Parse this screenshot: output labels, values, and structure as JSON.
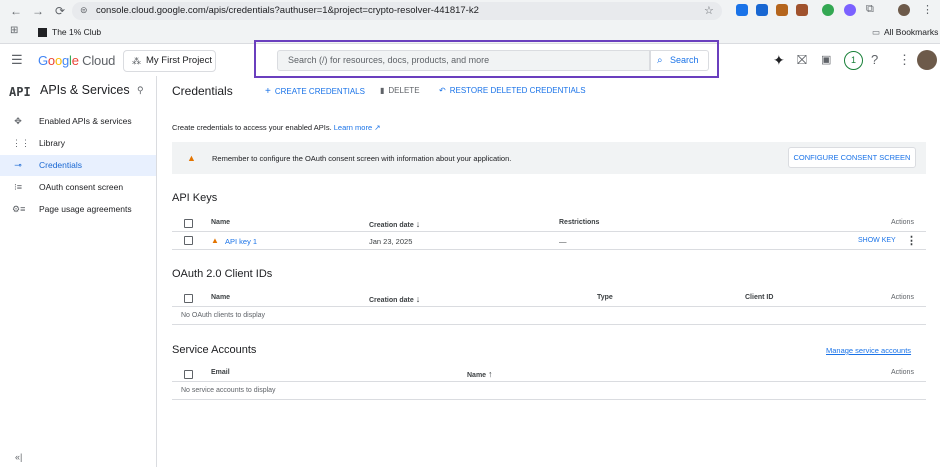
{
  "browser": {
    "url": "console.cloud.google.com/apis/credentials?authuser=1&project=crypto-resolver-441817-k2",
    "bookmarks": [
      "The 1% Club"
    ],
    "all_bookmarks": "All Bookmarks"
  },
  "header": {
    "logo": "Google Cloud",
    "project": "My First Project",
    "search_placeholder": "Search (/) for resources, docs, products, and more",
    "search_button": "Search",
    "notification_count": "1"
  },
  "sidebar": {
    "logo": "API",
    "title": "APIs & Services",
    "items": [
      {
        "label": "Enabled APIs & services",
        "icon": "enabled-apis-icon"
      },
      {
        "label": "Library",
        "icon": "library-icon"
      },
      {
        "label": "Credentials",
        "icon": "key-icon",
        "active": true
      },
      {
        "label": "OAuth consent screen",
        "icon": "oauth-icon"
      },
      {
        "label": "Page usage agreements",
        "icon": "settings-list-icon"
      }
    ]
  },
  "main": {
    "title": "Credentials",
    "toolbar": {
      "create": "CREATE CREDENTIALS",
      "delete": "DELETE",
      "restore": "RESTORE DELETED CREDENTIALS"
    },
    "intro_text": "Create credentials to access your enabled APIs.",
    "learn_more": "Learn more",
    "banner_text": "Remember to configure the OAuth consent screen with information about your application.",
    "banner_button": "CONFIGURE CONSENT SCREEN",
    "api_keys": {
      "title": "API Keys",
      "columns": [
        "Name",
        "Creation date",
        "Restrictions",
        "Actions"
      ],
      "rows": [
        {
          "name": "API key 1",
          "creation_date": "Jan 23, 2025",
          "restrictions": "—",
          "action": "SHOW KEY"
        }
      ]
    },
    "oauth": {
      "title": "OAuth 2.0 Client IDs",
      "columns": [
        "Name",
        "Creation date",
        "Type",
        "Client ID",
        "Actions"
      ],
      "empty": "No OAuth clients to display"
    },
    "service_accounts": {
      "title": "Service Accounts",
      "manage_link": "Manage service accounts",
      "columns": [
        "Email",
        "Name",
        "Actions"
      ],
      "empty": "No service accounts to display"
    }
  },
  "colors": {
    "accent": "#1a73e8",
    "warning": "#e37400",
    "search_highlight": "#6a3fbe"
  }
}
